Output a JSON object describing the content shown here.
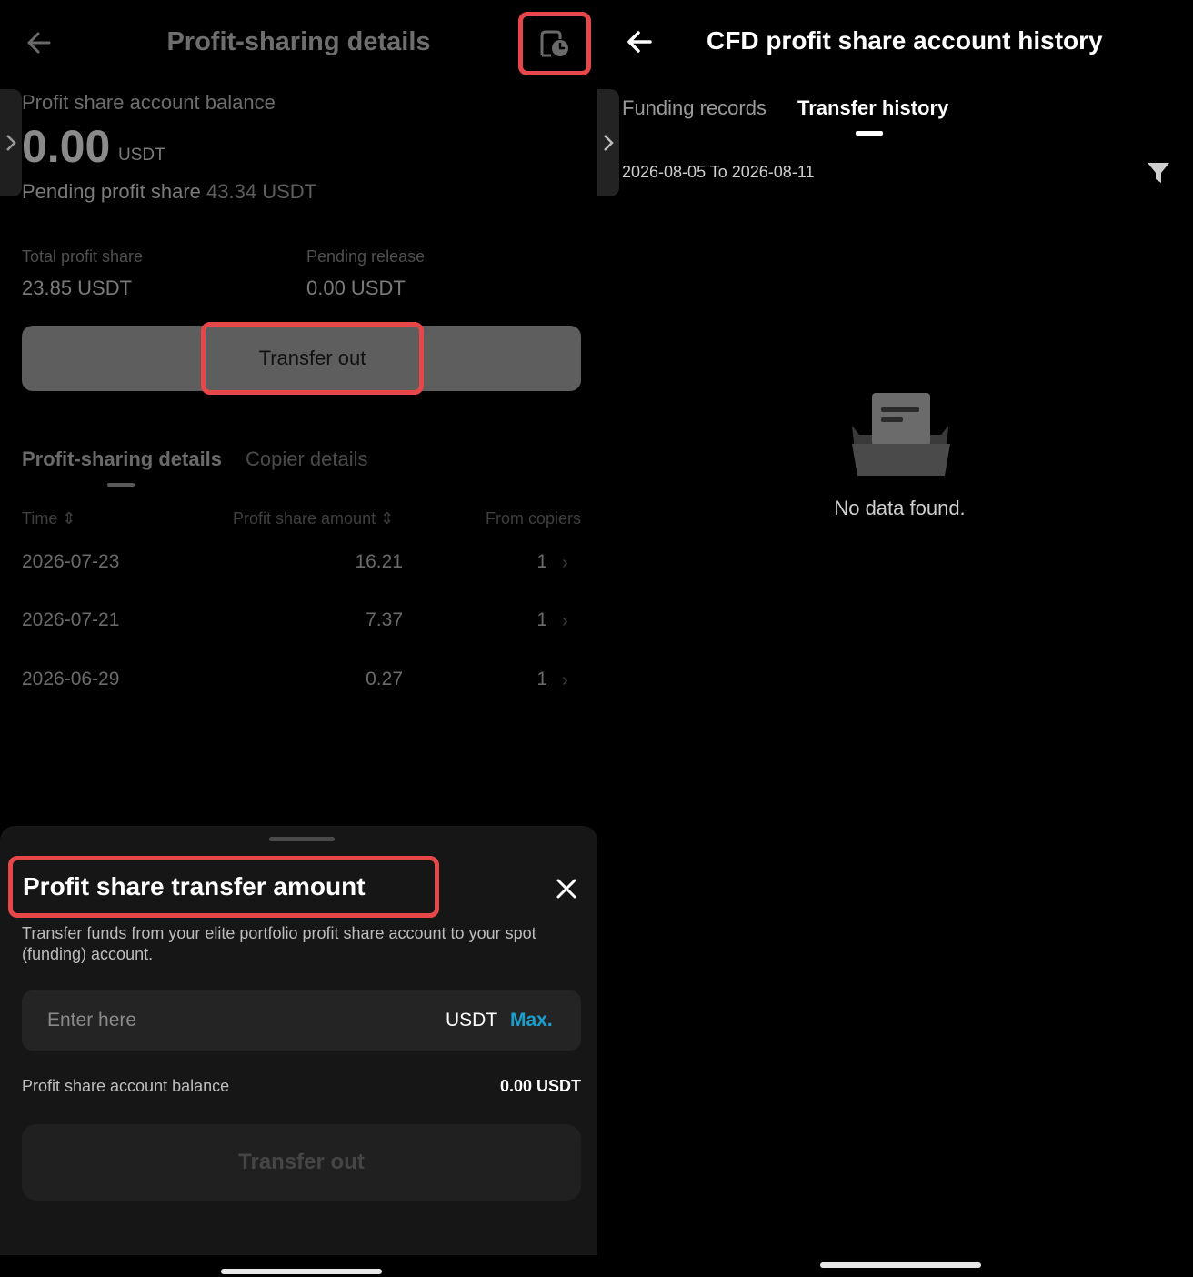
{
  "left": {
    "title": "Profit-sharing details",
    "balance": {
      "label": "Profit share account balance",
      "value": "0.00",
      "unit": "USDT"
    },
    "pending": {
      "label": "Pending profit share",
      "value": "43.34 USDT"
    },
    "stats": [
      {
        "label": "Total profit share",
        "value": "23.85 USDT"
      },
      {
        "label": "Pending release",
        "value": "0.00 USDT"
      }
    ],
    "transfer_button": "Transfer out",
    "tabs": [
      "Profit-sharing details",
      "Copier details"
    ],
    "table": {
      "headers": [
        "Time",
        "Profit share amount",
        "From copiers"
      ],
      "rows": [
        {
          "time": "2026-07-23",
          "amount": "16.21",
          "copiers": "1"
        },
        {
          "time": "2026-07-21",
          "amount": "7.37",
          "copiers": "1"
        },
        {
          "time": "2026-06-29",
          "amount": "0.27",
          "copiers": "1"
        }
      ]
    },
    "sheet": {
      "title": "Profit share transfer amount",
      "description": "Transfer funds from your elite portfolio profit share account to your spot (funding) account.",
      "input_placeholder": "Enter here",
      "unit": "USDT",
      "max_label": "Max.",
      "balance_label": "Profit share account balance",
      "balance_value": "0.00 USDT",
      "submit_label": "Transfer out"
    }
  },
  "right": {
    "title": "CFD profit share account history",
    "tabs": [
      "Funding records",
      "Transfer history"
    ],
    "active_tab": "Transfer history",
    "date_range": "2026-08-05 To 2026-08-11",
    "empty_text": "No data found."
  },
  "colors": {
    "highlight": "#e8474a",
    "accent": "#1aa0d0",
    "background": "#000000"
  },
  "icons": [
    "back-arrow-icon",
    "history-clock-icon",
    "chevron-right-icon",
    "sort-icon",
    "close-icon",
    "filter-icon",
    "empty-folder-icon"
  ]
}
